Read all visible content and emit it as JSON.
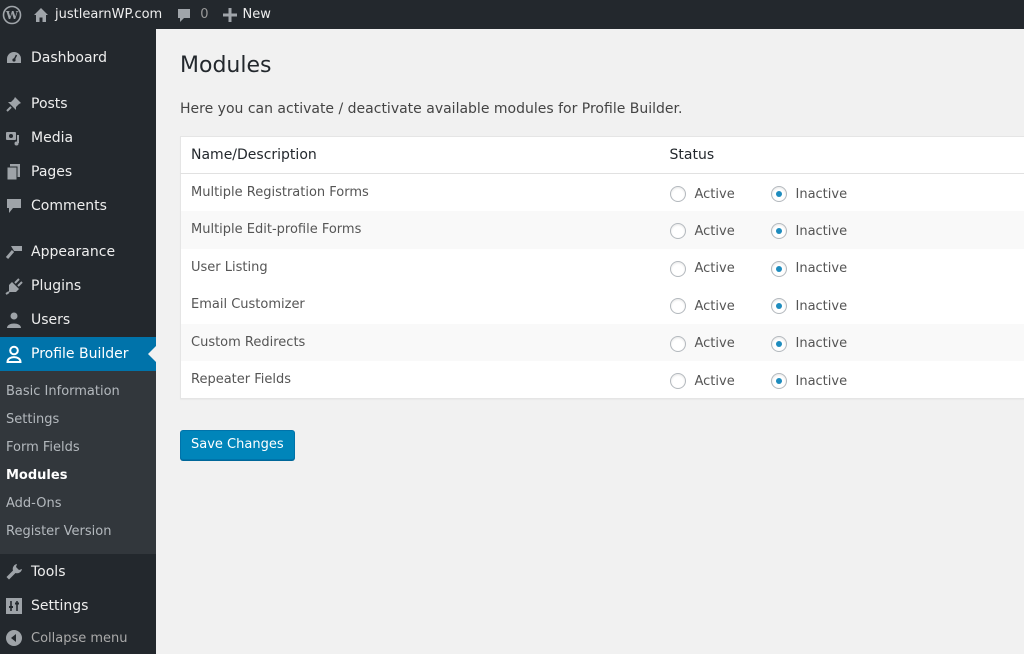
{
  "adminbar": {
    "site_name": "justlearnWP.com",
    "comments_count": "0",
    "new_label": "New"
  },
  "sidebar": {
    "items": [
      {
        "label": "Dashboard",
        "icon": "dashboard-icon"
      },
      {
        "label": "Posts",
        "icon": "pin-icon"
      },
      {
        "label": "Media",
        "icon": "media-icon"
      },
      {
        "label": "Pages",
        "icon": "pages-icon"
      },
      {
        "label": "Comments",
        "icon": "comment-icon"
      },
      {
        "label": "Appearance",
        "icon": "paintbrush-icon"
      },
      {
        "label": "Plugins",
        "icon": "plug-icon"
      },
      {
        "label": "Users",
        "icon": "user-icon"
      },
      {
        "label": "Profile Builder",
        "icon": "profile-icon",
        "current": true
      }
    ],
    "submenu": [
      {
        "label": "Basic Information"
      },
      {
        "label": "Settings"
      },
      {
        "label": "Form Fields"
      },
      {
        "label": "Modules",
        "current": true
      },
      {
        "label": "Add-Ons"
      },
      {
        "label": "Register Version"
      }
    ],
    "bottom_items": [
      {
        "label": "Tools",
        "icon": "wrench-icon"
      },
      {
        "label": "Settings",
        "icon": "sliders-icon"
      }
    ],
    "collapse_label": "Collapse menu"
  },
  "main": {
    "title": "Modules",
    "intro": "Here you can activate / deactivate available modules for Profile Builder.",
    "table": {
      "headers": [
        "Name/Description",
        "Status"
      ],
      "option_labels": {
        "active": "Active",
        "inactive": "Inactive"
      },
      "rows": [
        {
          "name": "Multiple Registration Forms",
          "status": "inactive"
        },
        {
          "name": "Multiple Edit-profile Forms",
          "status": "inactive"
        },
        {
          "name": "User Listing",
          "status": "inactive"
        },
        {
          "name": "Email Customizer",
          "status": "inactive"
        },
        {
          "name": "Custom Redirects",
          "status": "inactive"
        },
        {
          "name": "Repeater Fields",
          "status": "inactive"
        }
      ]
    },
    "save_label": "Save Changes"
  },
  "colors": {
    "accent": "#0073aa",
    "button": "#0085ba",
    "radio_dot": "#1e8cbe",
    "sidebar_bg": "#23282d",
    "submenu_bg": "#32373c"
  }
}
